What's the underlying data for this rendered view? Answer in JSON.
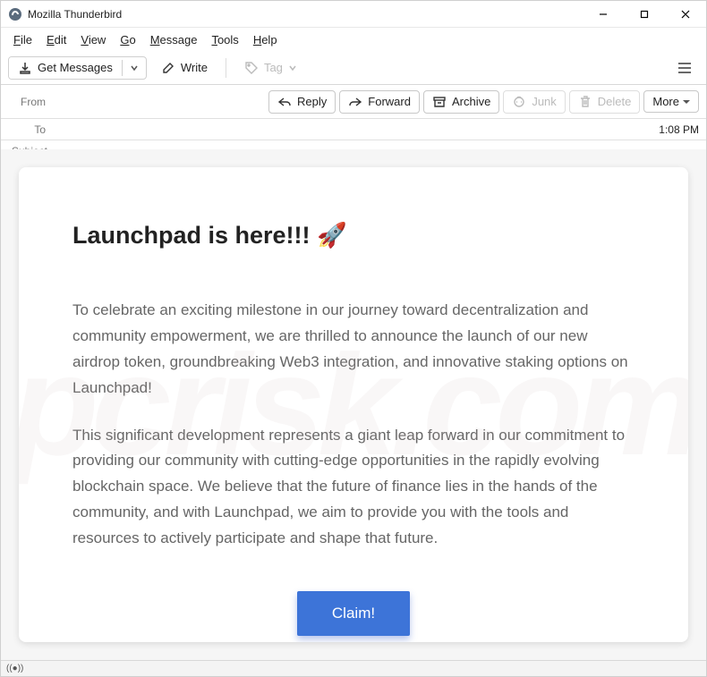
{
  "window": {
    "title": "Mozilla Thunderbird"
  },
  "menu": {
    "file": "File",
    "edit": "Edit",
    "view": "View",
    "go": "Go",
    "message": "Message",
    "tools": "Tools",
    "help": "Help"
  },
  "toolbar": {
    "get_messages": "Get Messages",
    "write": "Write",
    "tag": "Tag"
  },
  "header": {
    "from_label": "From",
    "to_label": "To",
    "subject_label": "Subject",
    "time": "1:08 PM",
    "actions": {
      "reply": "Reply",
      "forward": "Forward",
      "archive": "Archive",
      "junk": "Junk",
      "delete": "Delete",
      "more": "More"
    }
  },
  "email": {
    "heading": "Launchpad is here!!! 🚀",
    "para1": "To celebrate an exciting milestone in our journey toward decentralization and community empowerment, we are thrilled to announce the launch of our new airdrop token, groundbreaking Web3 integration, and innovative staking options on Launchpad!",
    "para2": "This significant development represents a giant leap forward in our commitment to providing our community with cutting-edge opportunities in the rapidly evolving blockchain space. We believe that the future of finance lies in the hands of the community, and with Launchpad, we aim to provide you with the tools and resources to actively participate and shape that future.",
    "cta": "Claim!"
  },
  "watermark": "pcrisk.com"
}
